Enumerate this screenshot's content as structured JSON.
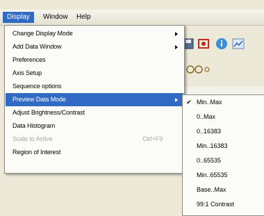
{
  "menubar": {
    "items": [
      {
        "label": "Display"
      },
      {
        "label": "Window"
      },
      {
        "label": "Help"
      }
    ]
  },
  "display_menu": {
    "items": [
      {
        "label": "Change Display Mode",
        "submenu": true
      },
      {
        "label": "Add Data Window",
        "submenu": true
      },
      {
        "label": "Preferences"
      },
      {
        "label": "Axis Setup"
      },
      {
        "label": "Sequence options"
      },
      {
        "label": "Preview Data Mode",
        "submenu": true,
        "highlighted": true
      },
      {
        "label": "Adjust Brightness/Contrast"
      },
      {
        "label": "Data Histogram"
      },
      {
        "label": "Scale to Active",
        "shortcut": "Ctrl+F9",
        "disabled": true
      },
      {
        "label": "Region of Interest"
      }
    ]
  },
  "preview_submenu": {
    "items": [
      {
        "label": "Min..Max",
        "checked": true
      },
      {
        "label": "0..Max"
      },
      {
        "label": "0..16383"
      },
      {
        "label": "Min..16383"
      },
      {
        "label": "0..65535"
      },
      {
        "label": "Min..65535"
      },
      {
        "label": "Base..Max"
      },
      {
        "label": "99:1 Contrast"
      }
    ],
    "check_glyph": "✔"
  },
  "colors": {
    "highlight": "#316ac5",
    "menu_bg": "#fbfbf8",
    "app_bg": "#ece9d8",
    "disabled_text": "#a9a79e"
  },
  "icons": [
    "save-icon",
    "record-icon",
    "info-icon",
    "chart-icon",
    "binoculars-icon"
  ]
}
